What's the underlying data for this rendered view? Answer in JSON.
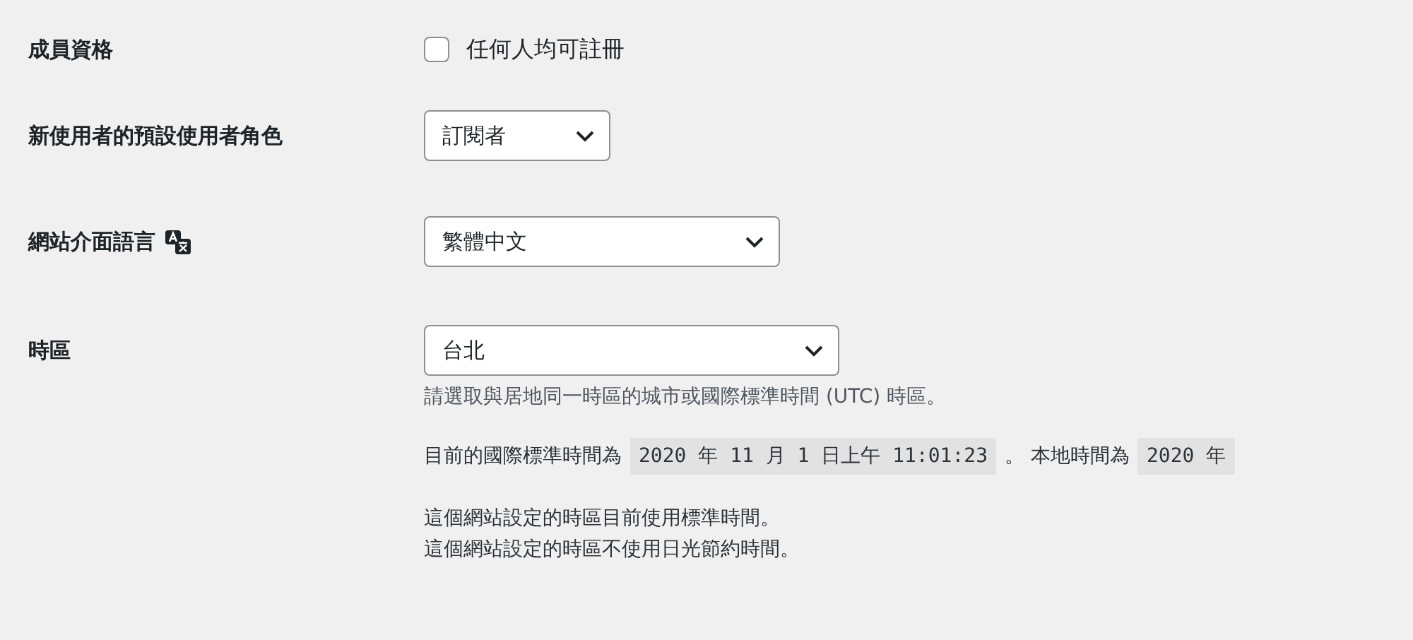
{
  "settings": [
    {
      "kind": "checkbox",
      "label": "成員資格",
      "option": "任何人均可註冊",
      "checked": false
    },
    {
      "kind": "select",
      "label": "新使用者的預設使用者角色",
      "value": "訂閱者"
    },
    {
      "kind": "language_select",
      "label": "網站介面語言",
      "value": "繁體中文"
    },
    {
      "kind": "timezone_select",
      "label": "時區",
      "value": "台北",
      "description": "請選取與居地同一時區的城市或國際標準時間 (UTC) 時區。",
      "utc_label": "目前的國際標準時間為",
      "utc_time": "2020 年 11 月 1 日上午 11:01:23",
      "local_label": "。 本地時間為",
      "local_time": "2020 年",
      "notes": [
        "這個網站設定的時區目前使用標準時間。",
        "這個網站設定的時區不使用日光節約時間。"
      ]
    }
  ]
}
